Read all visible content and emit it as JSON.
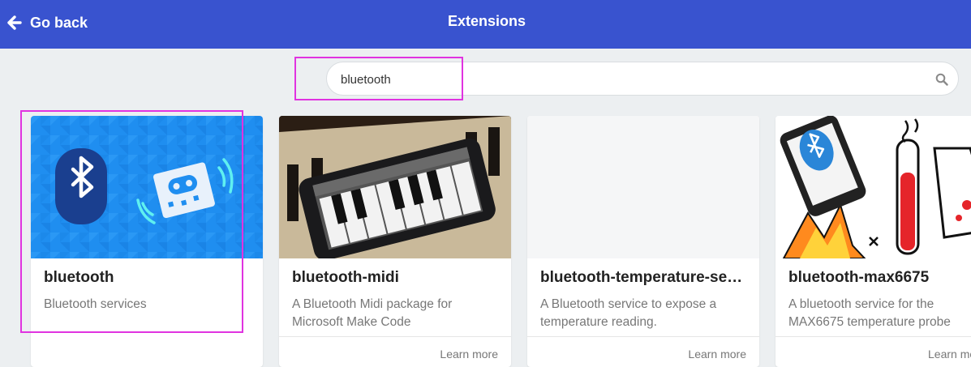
{
  "header": {
    "back_label": "Go back",
    "title": "Extensions",
    "background_color": "#3953cf"
  },
  "search": {
    "value": "bluetooth",
    "icon": "search-icon"
  },
  "highlight_color": "#e033e0",
  "cards": [
    {
      "title": "bluetooth",
      "description": "Bluetooth services",
      "link": "",
      "image": "bluetooth-microbit-illustration"
    },
    {
      "title": "bluetooth-midi",
      "description": "A Bluetooth Midi package for Microsoft Make Code",
      "link": "Learn more",
      "image": "phone-piano-app-photo"
    },
    {
      "title": "bluetooth-temperature-se…",
      "description": "A Bluetooth service to expose a temperature reading.",
      "link": "Learn more",
      "image": "blank-image"
    },
    {
      "title": "bluetooth-max6675",
      "description": "A bluetooth service for the MAX6675 temperature probe",
      "link": "Learn more",
      "image": "bluetooth-science-illustration"
    }
  ]
}
